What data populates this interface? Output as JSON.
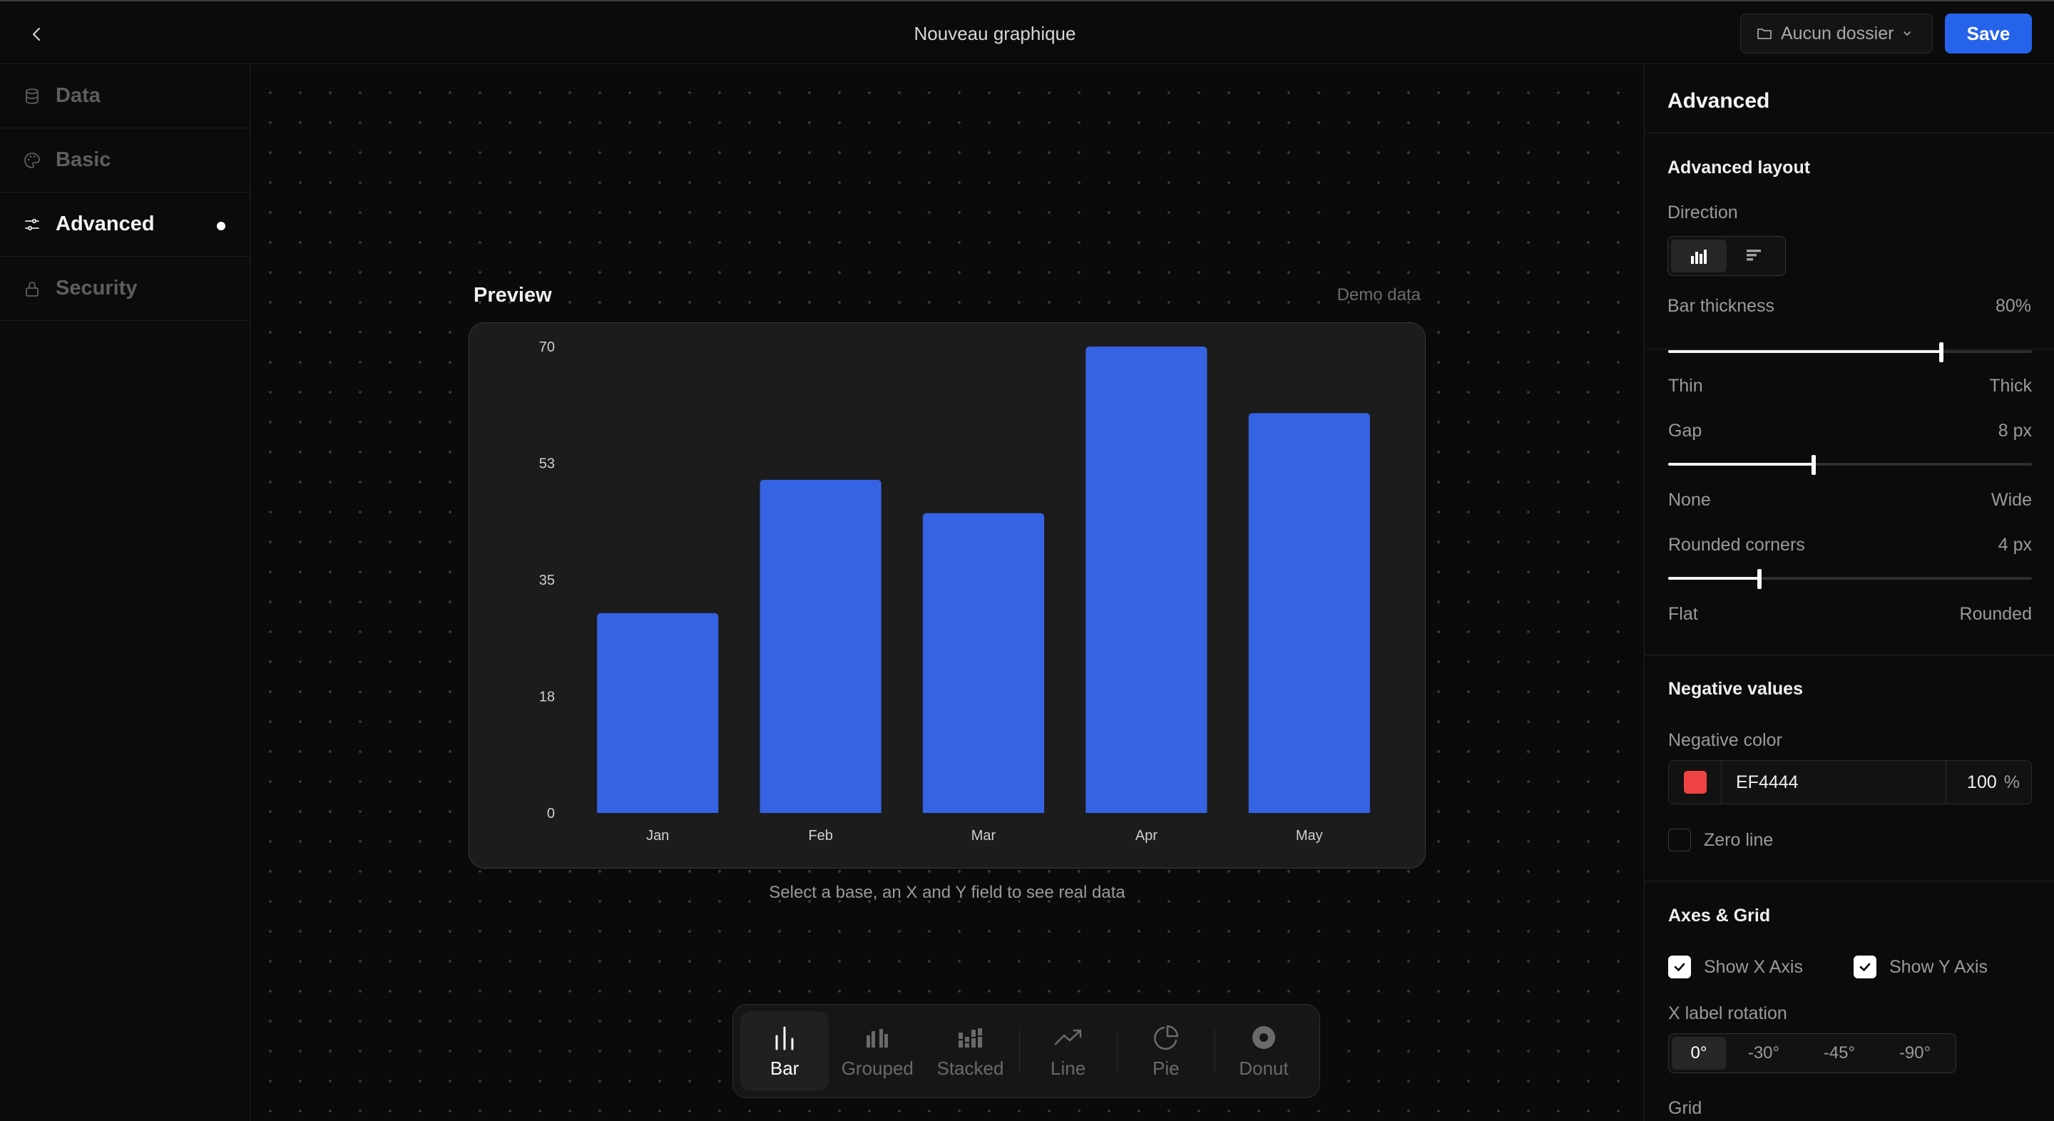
{
  "header": {
    "title": "Nouveau graphique",
    "folder_label": "Aucun dossier",
    "save_label": "Save"
  },
  "sidebar": {
    "items": [
      {
        "label": "Data",
        "icon": "database-icon",
        "active": false
      },
      {
        "label": "Basic",
        "icon": "palette-icon",
        "active": false
      },
      {
        "label": "Advanced",
        "icon": "sliders-icon",
        "active": true
      },
      {
        "label": "Security",
        "icon": "lock-icon",
        "active": false
      }
    ]
  },
  "preview": {
    "title": "Preview",
    "demo_label": "Demo data",
    "hint": "Select a base, an X and Y field to see real data"
  },
  "chart_data": {
    "type": "bar",
    "categories": [
      "Jan",
      "Feb",
      "Mar",
      "Apr",
      "May"
    ],
    "values": [
      30,
      50,
      45,
      70,
      60
    ],
    "yticks": [
      "0",
      "18",
      "35",
      "53",
      "70"
    ],
    "ylim": [
      0,
      70
    ],
    "bar_color": "#3563e3",
    "grid": false
  },
  "chart_types": [
    {
      "label": "Bar",
      "icon": "bar-chart-icon",
      "active": true
    },
    {
      "label": "Grouped",
      "icon": "grouped-bar-icon",
      "active": false
    },
    {
      "label": "Stacked",
      "icon": "stacked-bar-icon",
      "active": false
    },
    {
      "label": "Line",
      "icon": "line-chart-icon",
      "active": false
    },
    {
      "label": "Pie",
      "icon": "pie-chart-icon",
      "active": false
    },
    {
      "label": "Donut",
      "icon": "donut-chart-icon",
      "active": false
    }
  ],
  "panel": {
    "title": "Advanced",
    "layout": {
      "title": "Advanced layout",
      "direction_label": "Direction",
      "bar_thickness": {
        "label": "Bar thickness",
        "value": "80%",
        "fraction": 0.75,
        "min": "Thin",
        "max": "Thick"
      },
      "gap": {
        "label": "Gap",
        "value": "8 px",
        "fraction": 0.4,
        "min": "None",
        "max": "Wide"
      },
      "corners": {
        "label": "Rounded corners",
        "value": "4 px",
        "fraction": 0.25,
        "min": "Flat",
        "max": "Rounded"
      }
    },
    "negative": {
      "title": "Negative values",
      "color_label": "Negative color",
      "color_hex": "EF4444",
      "swatch": "#EF4444",
      "opacity": "100",
      "opacity_unit": "%",
      "zero_line": "Zero line"
    },
    "axes": {
      "title": "Axes & Grid",
      "show_x": "Show X Axis",
      "show_y": "Show Y Axis",
      "rotation_label": "X label rotation",
      "rotations": [
        "0°",
        "-30°",
        "-45°",
        "-90°"
      ],
      "grid_label": "Grid"
    }
  }
}
